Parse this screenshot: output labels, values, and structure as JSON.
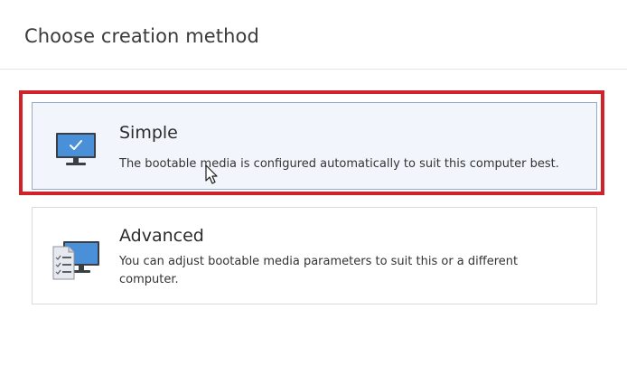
{
  "header": {
    "title": "Choose creation method"
  },
  "options": [
    {
      "title": "Simple",
      "description": "The bootable media is configured automatically to suit this computer best.",
      "icon": "monitor-check-icon",
      "selected": true
    },
    {
      "title": "Advanced",
      "description": "You can adjust bootable media parameters to suit this or a different computer.",
      "icon": "monitor-checklist-icon",
      "selected": false
    }
  ],
  "colors": {
    "highlight": "#d0222a",
    "selected_card_bg": "#f2f6fc",
    "selected_card_border": "#93abc8",
    "monitor_blue": "#4a90d9"
  }
}
